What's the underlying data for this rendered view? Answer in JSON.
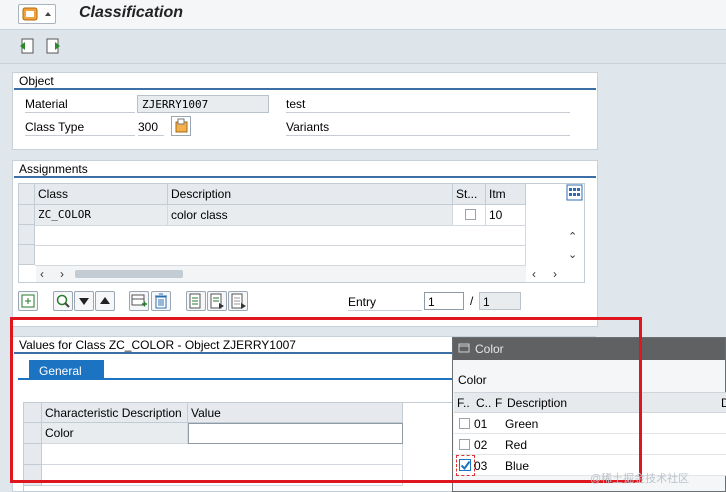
{
  "header": {
    "title": "Classification"
  },
  "object": {
    "title": "Object",
    "material_label": "Material",
    "material_value": "ZJERRY1007",
    "material_desc": "test",
    "classtype_label": "Class Type",
    "classtype_value": "300",
    "classtype_desc": "Variants"
  },
  "assignments": {
    "title": "Assignments",
    "columns": [
      "Class",
      "Description",
      "St...",
      "Itm"
    ],
    "rows": [
      {
        "class": "ZC_COLOR",
        "description": "color class",
        "itm": "10"
      }
    ],
    "entry_label": "Entry",
    "entry_current": "1",
    "entry_sep": "/",
    "entry_total": "1"
  },
  "values": {
    "title": "Values for Class ZC_COLOR - Object ZJERRY1007",
    "tab": "General",
    "columns": [
      "Characteristic Description",
      "Value"
    ],
    "rows": [
      {
        "char": "Color",
        "value": ""
      }
    ]
  },
  "popup": {
    "title": "Color",
    "label": "Color",
    "columns": [
      "F..",
      "C..",
      "F",
      "Description",
      "D"
    ],
    "rows": [
      {
        "code": "01",
        "description": "Green",
        "checked": false
      },
      {
        "code": "02",
        "description": "Red",
        "checked": false
      },
      {
        "code": "03",
        "description": "Blue",
        "checked": true
      }
    ]
  },
  "watermark": "@稀土掘金技术社区",
  "colors": {
    "accent": "#1b73c2",
    "highlight": "#e0161f",
    "panel_line": "#3b6fa5"
  }
}
